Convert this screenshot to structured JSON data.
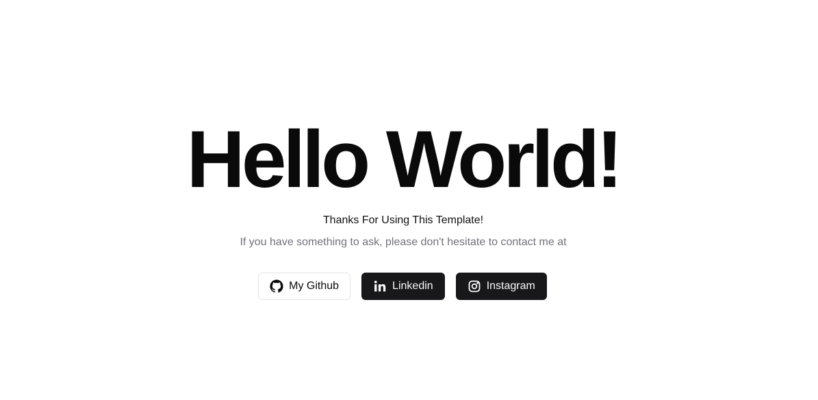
{
  "hero": {
    "title": "Hello World!",
    "subtitle": "Thanks For Using This Template!",
    "description": "If you have something to ask, please don't hesitate to contact me at"
  },
  "buttons": [
    {
      "label": "My Github",
      "icon": "github-icon",
      "style": "outline"
    },
    {
      "label": "Linkedin",
      "icon": "linkedin-icon",
      "style": "dark"
    },
    {
      "label": "Instagram",
      "icon": "instagram-icon",
      "style": "dark"
    }
  ],
  "colors": {
    "background": "#ffffff",
    "text": "#0a0a0a",
    "muted": "#71717a",
    "dark_button": "#18181b",
    "outline_border": "#e4e4e7"
  }
}
